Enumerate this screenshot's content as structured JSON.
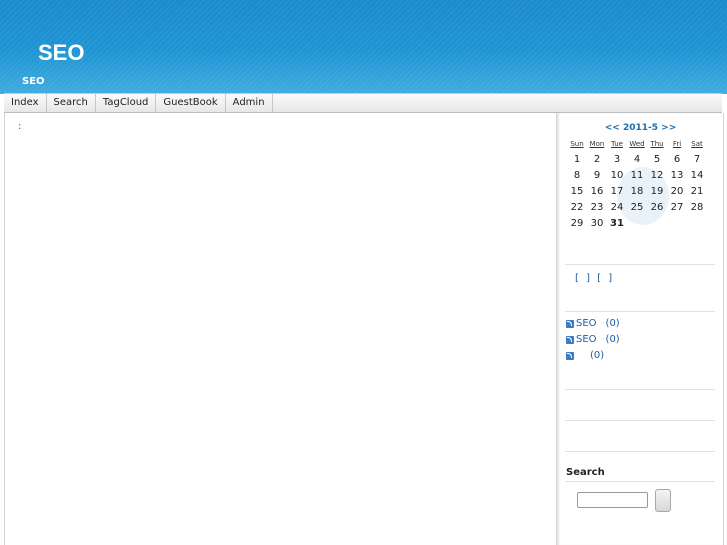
{
  "header": {
    "title": "SEO",
    "subtitle": "SEO"
  },
  "nav": {
    "items": [
      "Index",
      "Search",
      "TagCloud",
      "GuestBook",
      "Admin"
    ]
  },
  "content": {
    "text": ":"
  },
  "calendar": {
    "prev": "<<",
    "month_label": "2011-5",
    "next": ">>",
    "weekdays": [
      "Sun",
      "Mon",
      "Tue",
      "Wed",
      "Thu",
      "Fri",
      "Sat"
    ],
    "weeks": [
      [
        "1",
        "2",
        "3",
        "4",
        "5",
        "6",
        "7"
      ],
      [
        "8",
        "9",
        "10",
        "11",
        "12",
        "13",
        "14"
      ],
      [
        "15",
        "16",
        "17",
        "18",
        "19",
        "20",
        "21"
      ],
      [
        "22",
        "23",
        "24",
        "25",
        "26",
        "27",
        "28"
      ],
      [
        "29",
        "30",
        "31",
        "",
        "",
        "",
        ""
      ]
    ],
    "today": "31"
  },
  "tags": {
    "text": "[ ] [ ]"
  },
  "feeds": [
    {
      "label": "SEO",
      "count": "(0)"
    },
    {
      "label": "SEO",
      "count": "(0)"
    },
    {
      "label": "",
      "count": "(0)"
    }
  ],
  "search": {
    "heading": "Search",
    "placeholder": ""
  }
}
